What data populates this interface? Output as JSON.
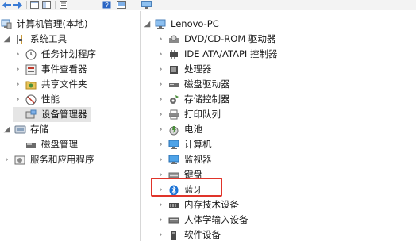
{
  "colors": {
    "highlight": "#e0342a",
    "selection": "#e5e5e5",
    "bluetooth": "#1e74d6"
  },
  "toolbar": {
    "icons": [
      "back-icon",
      "forward-icon",
      "up-icon",
      "show-hide-icon",
      "properties-icon",
      "help-icon",
      "console-icon"
    ]
  },
  "left_tree": {
    "items": [
      {
        "label": "计算机管理(本地)",
        "icon": "computer-management-icon"
      },
      {
        "label": "系统工具",
        "icon": "system-tools-icon"
      },
      {
        "label": "任务计划程序",
        "icon": "task-scheduler-icon"
      },
      {
        "label": "事件查看器",
        "icon": "event-viewer-icon"
      },
      {
        "label": "共享文件夹",
        "icon": "shared-folders-icon"
      },
      {
        "label": "性能",
        "icon": "performance-icon"
      },
      {
        "label": "设备管理器",
        "icon": "device-manager-icon"
      },
      {
        "label": "存储",
        "icon": "storage-icon"
      },
      {
        "label": "磁盘管理",
        "icon": "disk-management-icon"
      },
      {
        "label": "服务和应用程序",
        "icon": "services-apps-icon"
      }
    ]
  },
  "device_tree": {
    "root": {
      "label": "Lenovo-PC",
      "icon": "computer-icon"
    },
    "items": [
      {
        "label": "DVD/CD-ROM 驱动器",
        "icon": "dvd-drive-icon"
      },
      {
        "label": "IDE ATA/ATAPI 控制器",
        "icon": "ide-controller-icon"
      },
      {
        "label": "处理器",
        "icon": "processor-icon"
      },
      {
        "label": "磁盘驱动器",
        "icon": "disk-drive-icon"
      },
      {
        "label": "存储控制器",
        "icon": "storage-controller-icon"
      },
      {
        "label": "打印队列",
        "icon": "print-queue-icon"
      },
      {
        "label": "电池",
        "icon": "battery-icon"
      },
      {
        "label": "计算机",
        "icon": "computer-icon"
      },
      {
        "label": "监视器",
        "icon": "monitor-icon"
      },
      {
        "label": "键盘",
        "icon": "keyboard-icon"
      },
      {
        "label": "蓝牙",
        "icon": "bluetooth-icon"
      },
      {
        "label": "内存技术设备",
        "icon": "memory-device-icon"
      },
      {
        "label": "人体学输入设备",
        "icon": "hid-icon"
      },
      {
        "label": "软件设备",
        "icon": "software-device-icon"
      }
    ]
  }
}
